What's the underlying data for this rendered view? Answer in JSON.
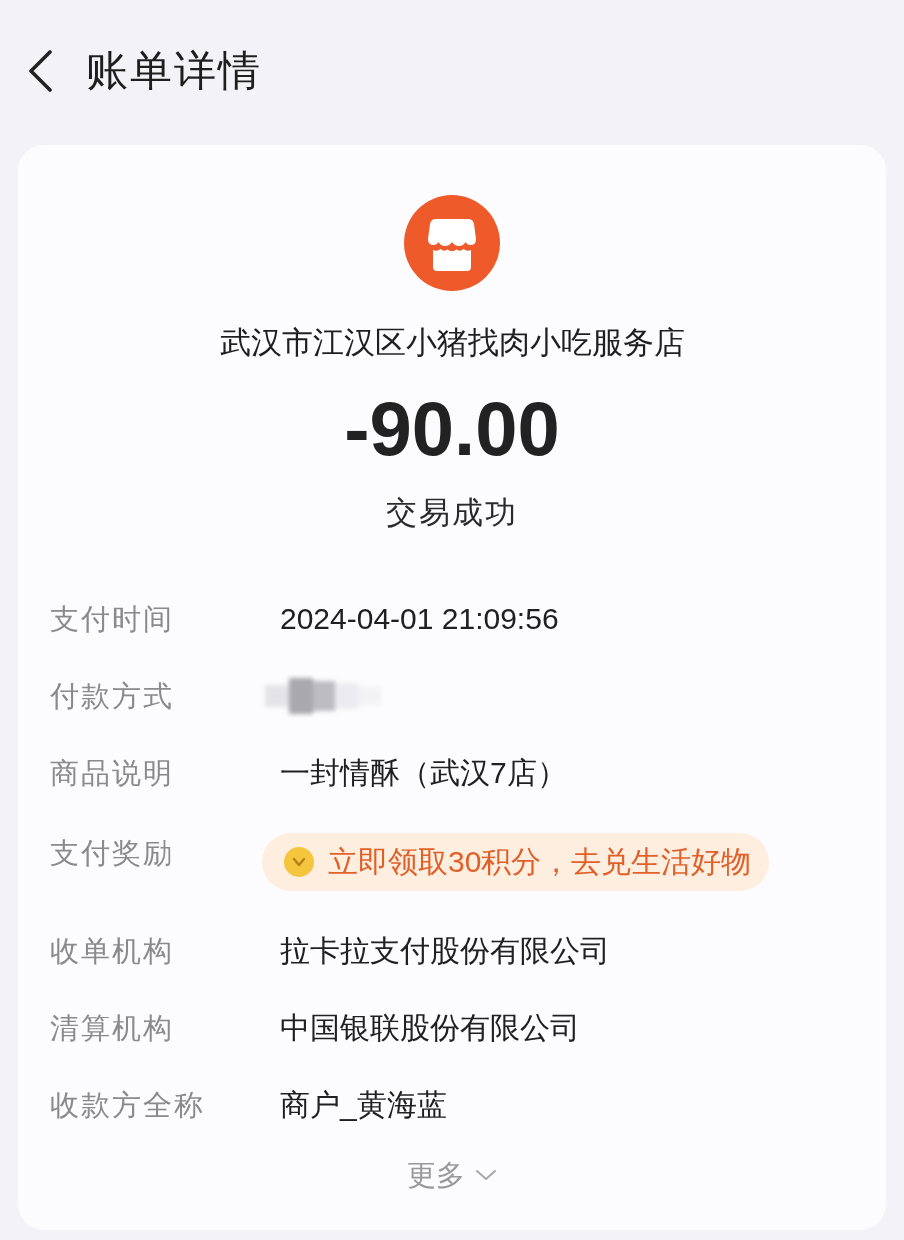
{
  "header": {
    "title": "账单详情"
  },
  "merchant": {
    "name": "武汉市江汉区小猪找肉小吃服务店",
    "amount": "-90.00",
    "status": "交易成功"
  },
  "details": [
    {
      "kind": "text",
      "label": "支付时间",
      "value": "2024-04-01 21:09:56"
    },
    {
      "kind": "redacted",
      "label": "付款方式"
    },
    {
      "kind": "text",
      "label": "商品说明",
      "value": "一封情酥（武汉7店）"
    },
    {
      "kind": "reward",
      "label": "支付奖励",
      "value": "立即领取30积分，去兑生活好物"
    },
    {
      "kind": "text",
      "label": "收单机构",
      "value": "拉卡拉支付股份有限公司"
    },
    {
      "kind": "text",
      "label": "清算机构",
      "value": "中国银联股份有限公司"
    },
    {
      "kind": "text",
      "label": "收款方全称",
      "value": "商户_黄海蓝"
    }
  ],
  "more": {
    "label": "更多",
    "expanded": false
  }
}
